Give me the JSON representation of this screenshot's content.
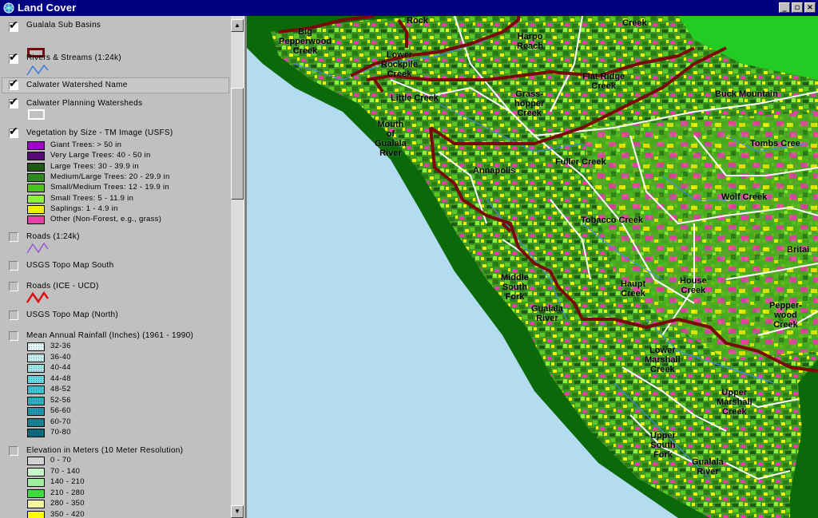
{
  "window": {
    "title": "Land Cover",
    "buttons": {
      "minimize": "_",
      "maximize": "▫",
      "close": "×"
    }
  },
  "legend": {
    "layers": [
      {
        "name": "Gualala Sub Basins",
        "checked": true,
        "symbol": "polygon-dark-red"
      },
      {
        "name": "Rivers & Streams (1:24k)",
        "checked": true,
        "symbol": "line-blue"
      },
      {
        "name": "Calwater Watershed Name",
        "checked": true,
        "symbol": "none"
      },
      {
        "name": "Calwater Planning Watersheds",
        "checked": true,
        "symbol": "polygon-white"
      },
      {
        "name": "Vegetation by Size - TM Image (USFS)",
        "checked": true,
        "symbol": "classes"
      },
      {
        "name": "Roads (1:24k)",
        "checked": false,
        "symbol": "line-purple"
      },
      {
        "name": "USGS Topo Map South",
        "checked": false,
        "symbol": "none"
      },
      {
        "name": "Roads (ICE - UCD)",
        "checked": false,
        "symbol": "line-red"
      },
      {
        "name": "USGS Topo Map (North)",
        "checked": false,
        "symbol": "none"
      },
      {
        "name": "Mean Annual Rainfall (Inches) (1961 - 1990)",
        "checked": false,
        "symbol": "classes"
      },
      {
        "name": "Elevation in Meters (10 Meter Resolution)",
        "checked": false,
        "symbol": "classes"
      }
    ],
    "vegetation_classes": [
      {
        "label": "Giant Trees: > 50 in",
        "color": "#a000c8"
      },
      {
        "label": "Very Large Trees: 40 - 50 in",
        "color": "#5a0a78"
      },
      {
        "label": "Large Trees: 30 - 39.9 in",
        "color": "#1e5a14"
      },
      {
        "label": "Medium/Large Trees: 20 - 29.9 in",
        "color": "#2f8a1e"
      },
      {
        "label": "Small/Medium Trees: 12 - 19.9 in",
        "color": "#4cc21c"
      },
      {
        "label": "Small Trees: 5 - 11.9 in",
        "color": "#8cf03c"
      },
      {
        "label": "Saplings: 1 - 4.9 in",
        "color": "#f0f000"
      },
      {
        "label": "Other (Non-Forest, e.g., grass)",
        "color": "#e640a8"
      }
    ],
    "rainfall_classes": [
      {
        "label": "32-36",
        "color": "#e6fafa"
      },
      {
        "label": "36-40",
        "color": "#c8f2f2"
      },
      {
        "label": "40-44",
        "color": "#a0eaea"
      },
      {
        "label": "44-48",
        "color": "#64dce6"
      },
      {
        "label": "48-52",
        "color": "#3cc8d6"
      },
      {
        "label": "52-56",
        "color": "#28b4c4"
      },
      {
        "label": "56-60",
        "color": "#1e9ab0"
      },
      {
        "label": "60-70",
        "color": "#168498"
      },
      {
        "label": "70-80",
        "color": "#0e6c80"
      }
    ],
    "elevation_classes": [
      {
        "label": "0 - 70",
        "color": "#d2d2d2"
      },
      {
        "label": "70 - 140",
        "color": "#c8f5c8"
      },
      {
        "label": "140 - 210",
        "color": "#a0f0a0"
      },
      {
        "label": "210 - 280",
        "color": "#3cdc3c"
      },
      {
        "label": "280 - 350",
        "color": "#f5f5a0"
      },
      {
        "label": "350 - 420",
        "color": "#ffff00"
      }
    ]
  },
  "map": {
    "ocean_color": "#b4dcf0",
    "coast_color": "#0a6a0a",
    "labels": [
      {
        "text": "Rock"
      },
      {
        "text": "Creek"
      },
      {
        "text": "Big\nPepperwood\nCreek"
      },
      {
        "text": "Harpo\nReach"
      },
      {
        "text": "Lower\nRockpile\nCreek"
      },
      {
        "text": "Flat Ridge\nCreek"
      },
      {
        "text": "Grass-\nhopper\nCreek"
      },
      {
        "text": "Little Creek"
      },
      {
        "text": "Buck Mountain"
      },
      {
        "text": "Mouth\nof\nGualala\nRiver"
      },
      {
        "text": "Tombs Cree"
      },
      {
        "text": "Fuller Creek"
      },
      {
        "text": "Annapolis"
      },
      {
        "text": "Wolf Creek"
      },
      {
        "text": "Tobacco Creek"
      },
      {
        "text": "Britai"
      },
      {
        "text": "Middle\nSouth\nFork"
      },
      {
        "text": "Gualala\nRiver"
      },
      {
        "text": "Haupt\nCreek"
      },
      {
        "text": "House\nCreek"
      },
      {
        "text": "Pepper-\nwood\nCreek"
      },
      {
        "text": "Lower\nMarshall\nCreek"
      },
      {
        "text": "Upper\nMarshall\nCreek"
      },
      {
        "text": "Upper\nSouth\nFork"
      },
      {
        "text": "Gualala\nRiver"
      }
    ]
  }
}
